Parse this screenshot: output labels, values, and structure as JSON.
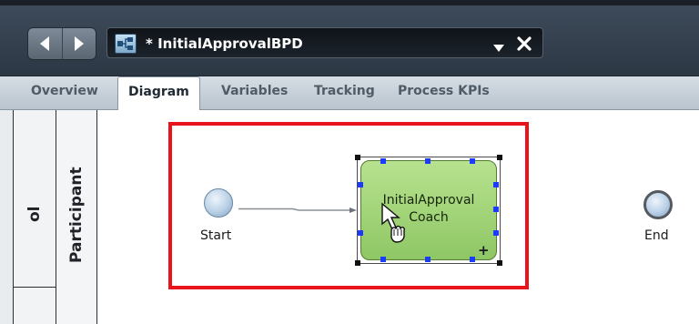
{
  "toolbar": {
    "back_icon": "left-arrow-icon",
    "forward_icon": "right-arrow-icon",
    "document_icon": "process-diagram-icon",
    "document_title": "* InitialApprovalBPD",
    "dropdown_icon": "chevron-down-icon",
    "close_icon": "close-icon"
  },
  "tabs": [
    {
      "label": "Overview",
      "active": false
    },
    {
      "label": "Diagram",
      "active": true
    },
    {
      "label": "Variables",
      "active": false
    },
    {
      "label": "Tracking",
      "active": false
    },
    {
      "label": "Process KPIs",
      "active": false
    }
  ],
  "lanes": {
    "pool_label": "ol",
    "participant_label": "Participant"
  },
  "diagram": {
    "start_label": "Start",
    "end_label": "End",
    "activity_line1": "InitialApproval",
    "activity_line2": "Coach",
    "activity_marker": "+",
    "highlight_color": "#e8131b",
    "activity_color": "#9fd374",
    "handle_color": "#1b3cff",
    "cursor_icon": "move-cursor-icon"
  }
}
